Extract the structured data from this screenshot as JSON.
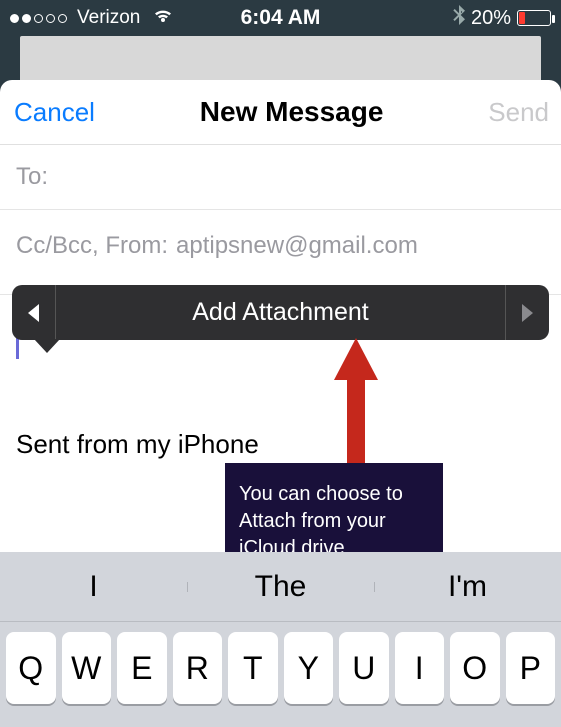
{
  "statusbar": {
    "carrier": "Verizon",
    "time": "6:04 AM",
    "battery_pct": "20%",
    "signal_filled": 2,
    "signal_total": 5
  },
  "sheet": {
    "cancel": "Cancel",
    "title": "New Message",
    "send": "Send",
    "to_label": "To:",
    "ccbcc_label": "Cc/Bcc, From:",
    "from_value": "aptipsnew@gmail.com",
    "signature": "Sent from my iPhone"
  },
  "context_menu": {
    "label": "Add Attachment"
  },
  "annotation": {
    "text": "You can choose to Attach from your iCloud drive"
  },
  "keyboard": {
    "predictions": [
      "I",
      "The",
      "I'm"
    ],
    "row1": [
      "Q",
      "W",
      "E",
      "R",
      "T",
      "Y",
      "U",
      "I",
      "O",
      "P"
    ]
  }
}
